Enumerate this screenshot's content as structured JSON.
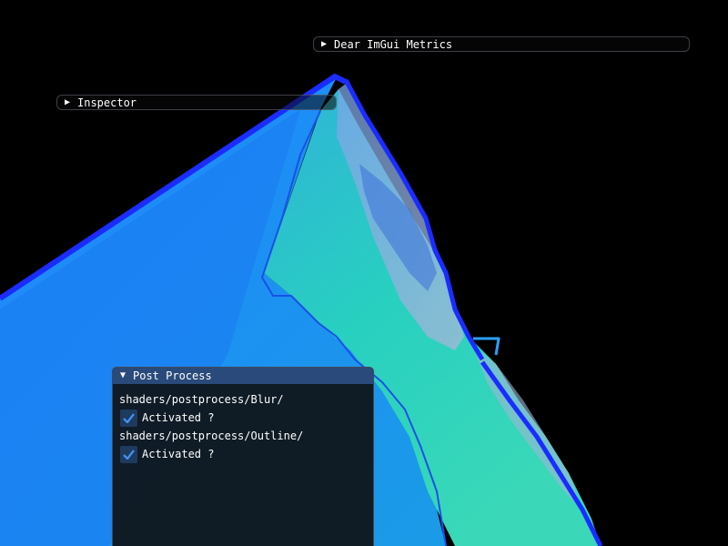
{
  "windows": {
    "metrics": {
      "title": "Dear ImGui Metrics",
      "collapsed_icon": "triangle-right-icon"
    },
    "inspector": {
      "title": "Inspector",
      "collapsed_icon": "triangle-right-icon"
    },
    "post_process": {
      "title": "Post Process",
      "expanded_icon": "triangle-down-icon",
      "shaders": [
        {
          "path": "shaders/postprocess/Blur/",
          "checkbox_label": "Activated ?",
          "checked": true
        },
        {
          "path": "shaders/postprocess/Outline/",
          "checkbox_label": "Activated ?",
          "checked": true
        }
      ]
    }
  },
  "colors": {
    "background": "#000000",
    "title_bar_active": "#294a7a",
    "checkbox_bg": "#1f3a5f",
    "checkmark": "#4296fa",
    "mesh_blue": "#1a7af0",
    "mesh_cyan": "#2ad6c4",
    "edge_blue": "#1530ff"
  }
}
